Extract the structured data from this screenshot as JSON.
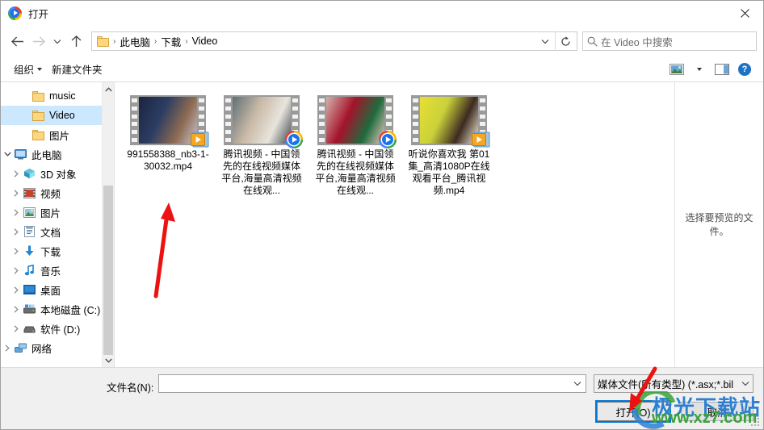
{
  "window": {
    "title": "打开",
    "icon": "media-player-icon",
    "close_label": "✕"
  },
  "nav": {
    "back_icon": "back-arrow-icon",
    "forward_icon": "forward-arrow-icon",
    "recent_icon": "chevron-down-icon",
    "up_icon": "up-arrow-icon",
    "breadcrumbs": [
      "此电脑",
      "下载",
      "Video"
    ],
    "separator": "›",
    "dropdown_icon": "chevron-down-icon",
    "refresh_icon": "refresh-icon",
    "search_placeholder": "在 Video 中搜索",
    "search_icon": "search-icon"
  },
  "toolbar": {
    "organize_label": "组织",
    "new_folder_label": "新建文件夹",
    "view_icon": "view-layout-icon",
    "view_caret_icon": "chevron-down-icon",
    "pane_icon": "preview-pane-icon",
    "help_icon": "help-icon",
    "help_label": "?"
  },
  "sidebar": {
    "items": [
      {
        "label": "music",
        "icon": "folder-icon",
        "indent": 2,
        "expander": "",
        "selected": false
      },
      {
        "label": "Video",
        "icon": "folder-icon",
        "indent": 2,
        "expander": "",
        "selected": true
      },
      {
        "label": "图片",
        "icon": "folder-icon",
        "indent": 2,
        "expander": "",
        "selected": false
      },
      {
        "label": "此电脑",
        "icon": "computer-icon",
        "indent": 0,
        "expander": "⌄",
        "selected": false
      },
      {
        "label": "3D 对象",
        "icon": "3d-objects-icon",
        "indent": 1,
        "expander": "›",
        "selected": false
      },
      {
        "label": "视频",
        "icon": "videos-icon",
        "indent": 1,
        "expander": "›",
        "selected": false
      },
      {
        "label": "图片",
        "icon": "pictures-icon",
        "indent": 1,
        "expander": "›",
        "selected": false
      },
      {
        "label": "文档",
        "icon": "documents-icon",
        "indent": 1,
        "expander": "›",
        "selected": false
      },
      {
        "label": "下载",
        "icon": "downloads-icon",
        "indent": 1,
        "expander": "›",
        "selected": false
      },
      {
        "label": "音乐",
        "icon": "music-icon",
        "indent": 1,
        "expander": "›",
        "selected": false
      },
      {
        "label": "桌面",
        "icon": "desktop-icon",
        "indent": 1,
        "expander": "›",
        "selected": false
      },
      {
        "label": "本地磁盘 (C:)",
        "icon": "local-disk-icon",
        "indent": 1,
        "expander": "›",
        "selected": false
      },
      {
        "label": "软件 (D:)",
        "icon": "drive-icon",
        "indent": 1,
        "expander": "›",
        "selected": false
      },
      {
        "label": "网络",
        "icon": "network-icon",
        "indent": 0,
        "expander": "›",
        "selected": false
      }
    ],
    "scroll_up_icon": "chevron-up-icon",
    "scroll_down_icon": "chevron-down-icon"
  },
  "files": [
    {
      "name": "991558388_nb3-1-30032.mp4",
      "badge": "media-player-badge-orange",
      "thumb_colors": [
        "#1b2440",
        "#2c3d63",
        "#8d6a52",
        "#c9c4cf"
      ]
    },
    {
      "name": "腾讯视频 - 中国领先的在线视频媒体平台,海量高清视频在线观...",
      "badge": "media-player-badge-blue",
      "thumb_colors": [
        "#5e6f74",
        "#c8b9a6",
        "#e8e4dc",
        "#3f4a52"
      ]
    },
    {
      "name": "腾讯视频 - 中国领先的在线视频媒体平台,海量高清视频在线观...",
      "badge": "media-player-badge-blue",
      "thumb_colors": [
        "#d4b2ab",
        "#a5132a",
        "#1f6b3d",
        "#e8c9c0"
      ]
    },
    {
      "name": "听说你喜欢我 第01集_高清1080P在线观看平台_腾讯视频.mp4",
      "badge": "media-player-badge-orange",
      "thumb_colors": [
        "#e8e033",
        "#c9d13a",
        "#3d2a20",
        "#f2efd8"
      ]
    }
  ],
  "preview": {
    "message": "选择要预览的文件。"
  },
  "footer": {
    "filename_label": "文件名(N):",
    "filename_value": "",
    "filename_chevron": "chevron-down-icon",
    "filetype_value": "媒体文件(所有类型) (*.asx;*.bil",
    "filetype_chevron": "chevron-down-icon",
    "open_label": "打开(O)",
    "cancel_label": "取消"
  },
  "watermark": {
    "brand": "极光下载站",
    "url": "www.xz7.com"
  },
  "colors": {
    "accent": "#0078d7",
    "selection": "#cce8ff",
    "arrow_red": "#ee1111",
    "folder_yellow": "#fcd77f"
  }
}
